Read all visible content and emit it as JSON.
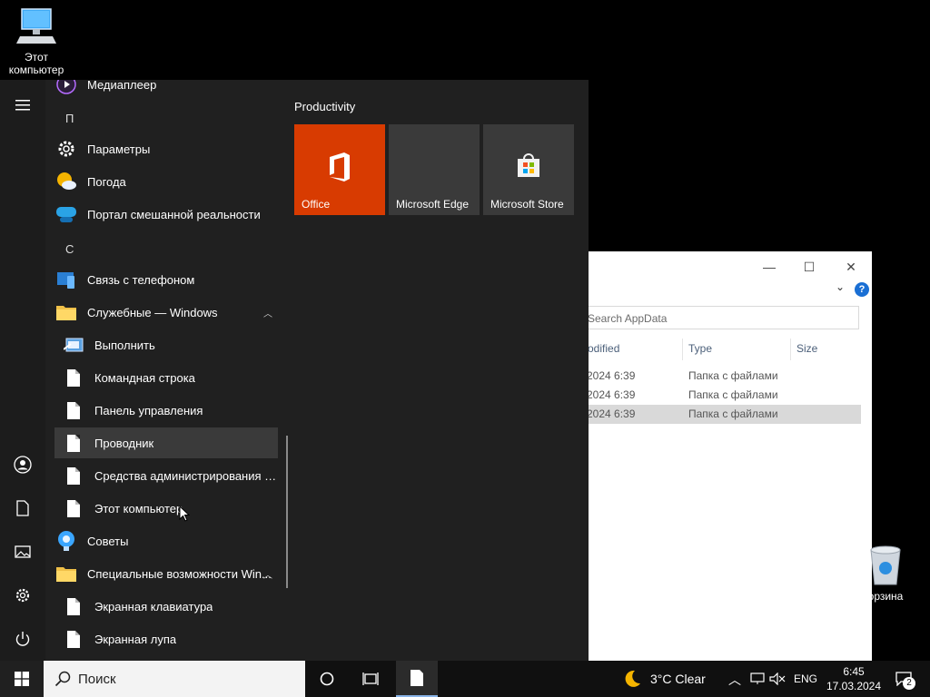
{
  "desktop": {
    "computer_label_line1": "Этот",
    "computer_label_line2": "компьютер",
    "recycle_label": "орзина"
  },
  "explorer": {
    "search_placeholder": "Search AppData",
    "col_modified": "odified",
    "col_type": "Type",
    "col_size": "Size",
    "rows": [
      {
        "date": "2024 6:39",
        "type": "Папка с файлами"
      },
      {
        "date": "2024 6:39",
        "type": "Папка с файлами"
      },
      {
        "date": "2024 6:39",
        "type": "Папка с файлами"
      }
    ],
    "minimize": "—",
    "maximize": "☐",
    "close": "✕",
    "expand": "⌄",
    "help": "?"
  },
  "start_menu": {
    "apps": {
      "mediaplayer": "Медиаплеер",
      "letter_p": "П",
      "settings": "Параметры",
      "weather": "Погода",
      "mixed_reality": "Портал смешанной реальности",
      "letter_s": "С",
      "phone": "Связь с телефоном",
      "win_tools": "Служебные — Windows",
      "run": "Выполнить",
      "cmd": "Командная строка",
      "control_panel": "Панель управления",
      "explorer": "Проводник",
      "admin_tools": "Средства администрирования Win...",
      "this_pc": "Этот компьютер",
      "tips": "Советы",
      "accessibility": "Специальные возможности Win...",
      "osk": "Экранная клавиатура",
      "magnifier": "Экранная лупа"
    },
    "tiles_group": "Productivity",
    "tiles": {
      "office": "Office",
      "edge": "Microsoft Edge",
      "store": "Microsoft Store"
    }
  },
  "taskbar": {
    "search_placeholder": "Поиск",
    "weather": "3°C  Clear",
    "lang": "ENG",
    "time": "6:45",
    "date": "17.03.2024",
    "notifications": "2"
  }
}
